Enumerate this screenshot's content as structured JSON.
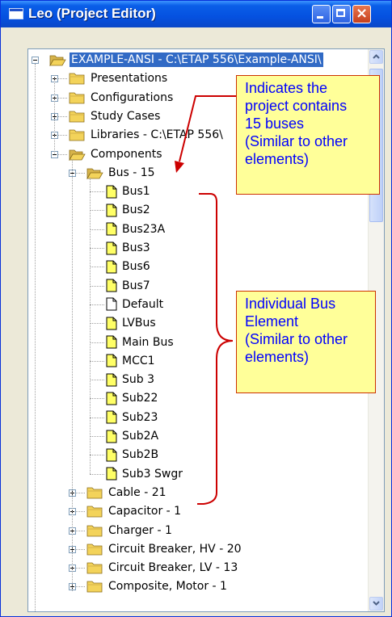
{
  "window": {
    "title": "Leo (Project Editor)",
    "controls": {
      "minimize": "minimize",
      "maximize": "maximize",
      "close": "×"
    },
    "colors": {
      "titlebar": "#0A5FE8",
      "selection": "#316AC5",
      "callout_bg": "#FFFF99",
      "callout_text": "#0000FF",
      "annotation_line": "#CC0000",
      "folder": "#F3D35A"
    }
  },
  "tree": {
    "root": {
      "label": "EXAMPLE-ANSI - C:\\ETAP 556\\Example-ANSI\\",
      "icon": "open-folder-icon",
      "selected": true
    },
    "level1": [
      {
        "label": "Presentations",
        "icon": "folder-icon",
        "expanded": false
      },
      {
        "label": "Configurations",
        "icon": "folder-icon",
        "expanded": false
      },
      {
        "label": "Study Cases",
        "icon": "folder-icon",
        "expanded": false
      },
      {
        "label": "Libraries - C:\\ETAP 556\\",
        "icon": "folder-icon",
        "expanded": false
      },
      {
        "label": "Components",
        "icon": "open-folder-icon",
        "expanded": true
      }
    ],
    "bus_group": {
      "label": "Bus - 15",
      "icon": "open-folder-icon",
      "expanded": true
    },
    "buses": [
      {
        "label": "Bus1",
        "icon": "bus-icon"
      },
      {
        "label": "Bus2",
        "icon": "bus-icon"
      },
      {
        "label": "Bus23A",
        "icon": "bus-icon"
      },
      {
        "label": "Bus3",
        "icon": "bus-icon"
      },
      {
        "label": "Bus6",
        "icon": "bus-icon"
      },
      {
        "label": "Bus7",
        "icon": "bus-icon"
      },
      {
        "label": "Default",
        "icon": "default-bus-icon"
      },
      {
        "label": "LVBus",
        "icon": "bus-icon"
      },
      {
        "label": "Main Bus",
        "icon": "bus-icon"
      },
      {
        "label": "MCC1",
        "icon": "bus-icon"
      },
      {
        "label": "Sub 3",
        "icon": "bus-icon"
      },
      {
        "label": "Sub22",
        "icon": "bus-icon"
      },
      {
        "label": "Sub23",
        "icon": "bus-icon"
      },
      {
        "label": "Sub2A",
        "icon": "bus-icon"
      },
      {
        "label": "Sub2B",
        "icon": "bus-icon"
      },
      {
        "label": "Sub3 Swgr",
        "icon": "bus-icon"
      }
    ],
    "component_groups": [
      {
        "label": "Cable - 21",
        "icon": "folder-icon",
        "expanded": false
      },
      {
        "label": "Capacitor - 1",
        "icon": "folder-icon",
        "expanded": false
      },
      {
        "label": "Charger - 1",
        "icon": "folder-icon",
        "expanded": false
      },
      {
        "label": "Circuit Breaker, HV - 20",
        "icon": "folder-icon",
        "expanded": false
      },
      {
        "label": "Circuit Breaker, LV - 13",
        "icon": "folder-icon",
        "expanded": false
      },
      {
        "label": "Composite, Motor - 1",
        "icon": "folder-icon",
        "expanded": false
      }
    ]
  },
  "callouts": [
    {
      "text": "Indicates the\nproject contains\n15 buses\n(Similar to other\nelements)"
    },
    {
      "text": "Individual Bus\nElement\n(Similar to other\nelements)"
    }
  ]
}
